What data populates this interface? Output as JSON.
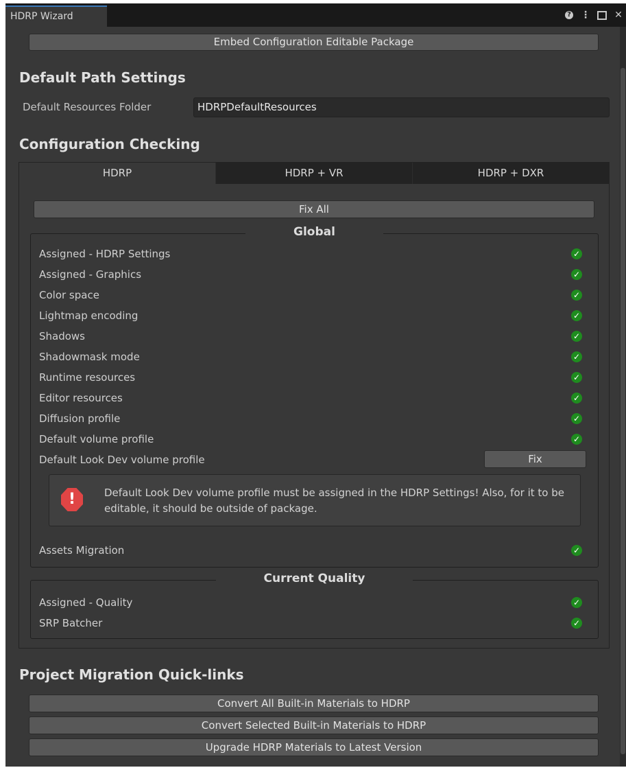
{
  "window": {
    "title": "HDRP Wizard",
    "icons": [
      "help-icon",
      "more-icon",
      "maximize-icon",
      "close-icon"
    ]
  },
  "embed_button": "Embed Configuration Editable Package",
  "default_path": {
    "heading": "Default Path Settings",
    "resources_label": "Default Resources Folder",
    "resources_value": "HDRPDefaultResources"
  },
  "config": {
    "heading": "Configuration Checking",
    "tabs": [
      "HDRP",
      "HDRP + VR",
      "HDRP + DXR"
    ],
    "active_tab": "HDRP",
    "fix_all": "Fix All",
    "global": {
      "title": "Global",
      "items": [
        {
          "label": "Assigned - HDRP Settings",
          "status": "ok"
        },
        {
          "label": "Assigned - Graphics",
          "status": "ok"
        },
        {
          "label": "Color space",
          "status": "ok"
        },
        {
          "label": "Lightmap encoding",
          "status": "ok"
        },
        {
          "label": "Shadows",
          "status": "ok"
        },
        {
          "label": "Shadowmask mode",
          "status": "ok"
        },
        {
          "label": "Runtime resources",
          "status": "ok"
        },
        {
          "label": "Editor resources",
          "status": "ok"
        },
        {
          "label": "Diffusion profile",
          "status": "ok"
        },
        {
          "label": "Default volume profile",
          "status": "ok"
        }
      ],
      "lookdev": {
        "label": "Default Look Dev volume profile",
        "fix_label": "Fix",
        "error": "Default Look Dev volume profile must be assigned in the HDRP Settings! Also, for it to be editable, it should be outside of package."
      },
      "assets_migration": {
        "label": "Assets Migration",
        "status": "ok"
      }
    },
    "quality": {
      "title": "Current Quality",
      "items": [
        {
          "label": "Assigned - Quality",
          "status": "ok"
        },
        {
          "label": "SRP Batcher",
          "status": "ok"
        }
      ]
    }
  },
  "migration": {
    "heading": "Project Migration Quick-links",
    "buttons": [
      "Convert All Built-in Materials to HDRP",
      "Convert Selected Built-in Materials to HDRP",
      "Upgrade HDRP Materials to Latest Version"
    ]
  },
  "colors": {
    "background": "#383838",
    "check_green": "#1f8c1f",
    "error_red": "#e04545",
    "tab_accent": "#3a79bb"
  }
}
